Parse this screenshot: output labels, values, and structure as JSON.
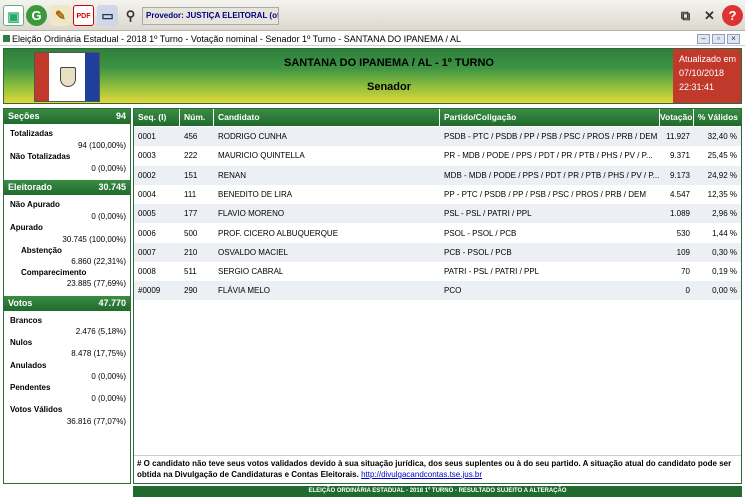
{
  "toolbar": {
    "provider_label": "Provedor: JUSTIÇA ELEITORAL (oficial)"
  },
  "window": {
    "title": "Eleição Ordinária Estadual - 2018 1º Turno - Votação nominal - Senador 1º Turno - SANTANA DO IPANEMA / AL"
  },
  "header": {
    "title": "SANTANA DO IPANEMA / AL - 1º TURNO",
    "subtitle": "Senador",
    "updated_label": "Atualizado em",
    "updated_date": "07/10/2018",
    "updated_time": "22:31:41"
  },
  "colors": {
    "header_green": "#2f7f3c",
    "header_yellow": "#e3d63a",
    "updated_red": "#c0392b",
    "accent_green": "#1f6a2c"
  },
  "left": {
    "secoes": {
      "label": "Seções",
      "value": "94"
    },
    "totalizadas": {
      "label": "Totalizadas",
      "value": "94 (100,00%)"
    },
    "nao_totalizadas": {
      "label": "Não Totalizadas",
      "value": "0 (0,00%)"
    },
    "eleitorado": {
      "label": "Eleitorado",
      "value": "30.745"
    },
    "nao_apurado": {
      "label": "Não Apurado",
      "value": "0 (0,00%)"
    },
    "apurado": {
      "label": "Apurado",
      "value": "30.745 (100,00%)"
    },
    "abstencao": {
      "label": "Abstenção",
      "value": "6.860 (22,31%)"
    },
    "comparecimento": {
      "label": "Comparecimento",
      "value": "23.885 (77,69%)"
    },
    "votos": {
      "label": "Votos",
      "value": "47.770"
    },
    "brancos": {
      "label": "Brancos",
      "value": "2.476 (5,18%)"
    },
    "nulos": {
      "label": "Nulos",
      "value": "8.478 (17,75%)"
    },
    "anulados": {
      "label": "Anulados",
      "value": "0 (0,00%)"
    },
    "pendentes": {
      "label": "Pendentes",
      "value": "0 (0,00%)"
    },
    "votos_validos": {
      "label": "Votos Válidos",
      "value": "36.816 (77,07%)"
    }
  },
  "table": {
    "headers": {
      "seq": "Seq.  (I)",
      "num": "Núm.",
      "cand": "Candidato",
      "partido": "Partido/Coligação",
      "votacao": "Votação",
      "validos": "% Válidos"
    },
    "rows": [
      {
        "seq": "0001",
        "num": "456",
        "cand": "RODRIGO CUNHA",
        "partido": "PSDB - PTC / PSDB / PP / PSB / PSC / PROS / PRB / DEM",
        "votacao": "11.927",
        "validos": "32,40 %"
      },
      {
        "seq": "0003",
        "num": "222",
        "cand": "MAURICIO QUINTELLA",
        "partido": "PR - MDB / PODE / PPS / PDT / PR / PTB / PHS / PV / P...",
        "votacao": "9.371",
        "validos": "25,45 %"
      },
      {
        "seq": "0002",
        "num": "151",
        "cand": "RENAN",
        "partido": "MDB - MDB / PODE / PPS / PDT / PR / PTB / PHS / PV / P...",
        "votacao": "9.173",
        "validos": "24,92 %"
      },
      {
        "seq": "0004",
        "num": "111",
        "cand": "BENEDITO DE LIRA",
        "partido": "PP - PTC / PSDB / PP / PSB / PSC / PROS / PRB / DEM",
        "votacao": "4.547",
        "validos": "12,35 %"
      },
      {
        "seq": "0005",
        "num": "177",
        "cand": "FLAVIO MORENO",
        "partido": "PSL - PSL / PATRI / PPL",
        "votacao": "1.089",
        "validos": "2,96 %"
      },
      {
        "seq": "0006",
        "num": "500",
        "cand": "PROF. CICERO ALBUQUERQUE",
        "partido": "PSOL - PSOL / PCB",
        "votacao": "530",
        "validos": "1,44 %"
      },
      {
        "seq": "0007",
        "num": "210",
        "cand": "OSVALDO MACIEL",
        "partido": "PCB - PSOL / PCB",
        "votacao": "109",
        "validos": "0,30 %"
      },
      {
        "seq": "0008",
        "num": "511",
        "cand": "SERGIO CABRAL",
        "partido": "PATRI - PSL / PATRI / PPL",
        "votacao": "70",
        "validos": "0,19 %"
      },
      {
        "seq": "#0009",
        "num": "290",
        "cand": "FLÁVIA MELO",
        "partido": "PCO",
        "votacao": "0",
        "validos": "0,00 %"
      }
    ]
  },
  "note": {
    "text": "# O candidato não teve seus votos validados devido à sua situação jurídica, dos seus suplentes ou à do seu partido. A situação atual do candidato pode ser obtida na Divulgação de Candidaturas e Contas Eleitorais.",
    "link": "http://divulgacandcontas.tse.jus.br"
  },
  "footer": "ELEIÇÃO ORDINÁRIA ESTADUAL - 2018 1º TURNO - RESULTADO SUJEITO A ALTERAÇÃO"
}
